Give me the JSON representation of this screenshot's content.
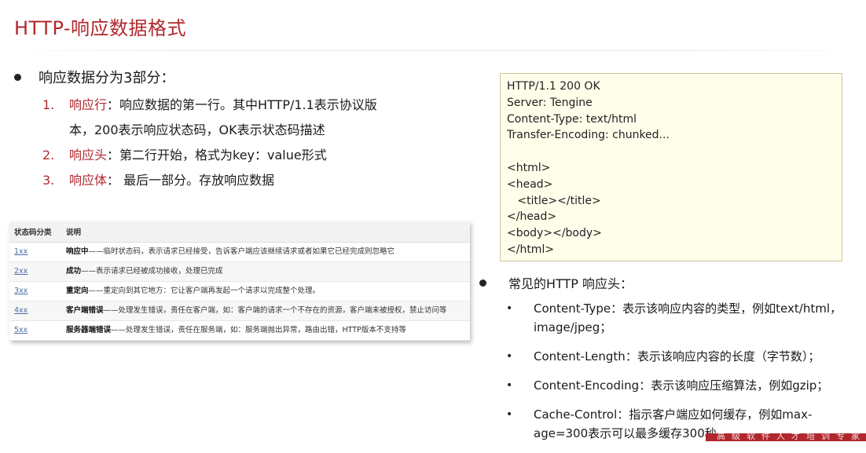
{
  "title": "HTTP-响应数据格式",
  "intro": "响应数据分为3部分：",
  "parts": [
    {
      "num": "1.",
      "term": "响应行",
      "desc": "：响应数据的第一行。其中HTTP/1.1表示协议版",
      "cont": "本，200表示响应状态码，OK表示状态码描述"
    },
    {
      "num": "2.",
      "term": "响应头",
      "desc": "：第二行开始，格式为key：value形式"
    },
    {
      "num": "3.",
      "term": "响应体",
      "desc": "：  最后一部分。存放响应数据"
    }
  ],
  "status_table": {
    "headers": [
      "状态码分类",
      "说明"
    ],
    "rows": [
      {
        "code": "1xx",
        "label": "响应中",
        "desc": "——临时状态码，表示请求已经接受，告诉客户端应该继续请求或者如果它已经完成则忽略它"
      },
      {
        "code": "2xx",
        "label": "成功",
        "desc": "——表示请求已经被成功接收，处理已完成"
      },
      {
        "code": "3xx",
        "label": "重定向",
        "desc": "——重定向到其它地方：它让客户端再发起一个请求以完成整个处理。"
      },
      {
        "code": "4xx",
        "label": "客户端错误",
        "desc": "——处理发生错误，责任在客户端，如：客户端的请求一个不存在的资源，客户端未被授权，禁止访问等"
      },
      {
        "code": "5xx",
        "label": "服务器端错误",
        "desc": "——处理发生错误，责任在服务端，如：服务端抛出异常，路由出错，HTTP版本不支持等"
      }
    ]
  },
  "code_lines": [
    "HTTP/1.1 200 OK",
    "Server: Tengine",
    "Content-Type: text/html",
    "Transfer-Encoding: chunked...",
    "",
    "<html>",
    "<head>",
    "   <title></title>",
    "</head>",
    "<body></body>",
    "</html>"
  ],
  "headers_title": "常见的HTTP 响应头：",
  "response_headers": [
    {
      "name": "Content-Type",
      "desc": "：表示该响应内容的类型，例如text/html，image/jpeg；"
    },
    {
      "name": "Content-Length",
      "desc": "：表示该响应内容的长度（字节数）；"
    },
    {
      "name": "Content-Encoding",
      "desc": "：表示该响应压缩算法，例如gzip；"
    },
    {
      "name": "Cache-Control",
      "desc": "：指示客户端应如何缓存，例如max-age=300表示可以最多缓存300秒"
    }
  ],
  "small_bullet": "•",
  "banner_text": "高级软件人才培训专家"
}
